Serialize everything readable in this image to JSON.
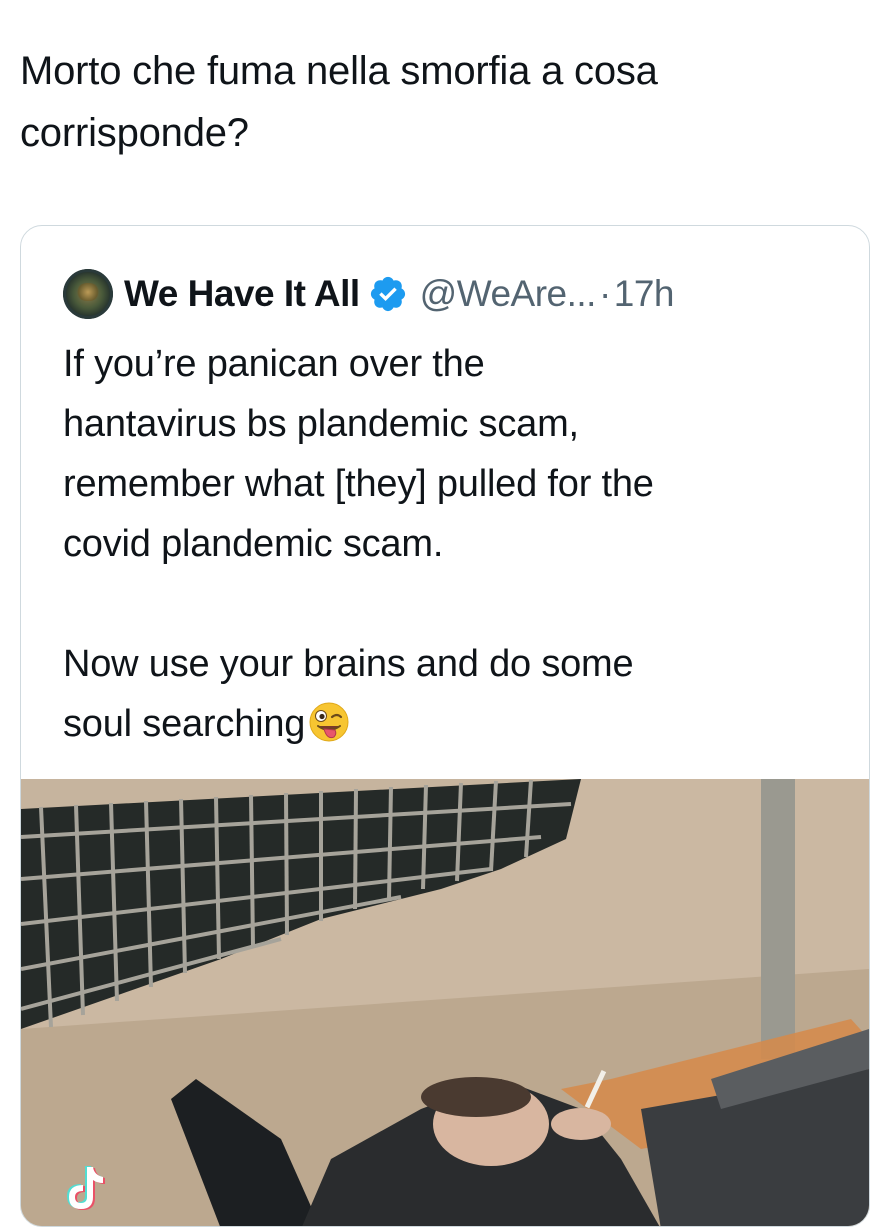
{
  "tweet": {
    "text_line_1": "Morto che fuma nella smorfia a cosa",
    "text_line_2": "corrisponde?"
  },
  "quoted_tweet": {
    "display_name": "We Have It All",
    "verified": true,
    "handle": "@WeAre...",
    "separator": "·",
    "time": "17h",
    "body_lines": [
      "If you’re panican over the",
      "hantavirus bs plandemic scam,",
      "remember what [they] pulled for the",
      "covid plandemic scam.",
      "",
      "Now use your brains and do some",
      "soul searching"
    ],
    "trailing_emoji": "winking-face-with-tongue",
    "media": {
      "type": "video-thumbnail",
      "watermark_icon": "tiktok-icon"
    }
  },
  "colors": {
    "text_primary": "#0f1419",
    "text_secondary": "#536471",
    "card_border": "#cfd9de",
    "verified_blue": "#1d9bf0"
  }
}
